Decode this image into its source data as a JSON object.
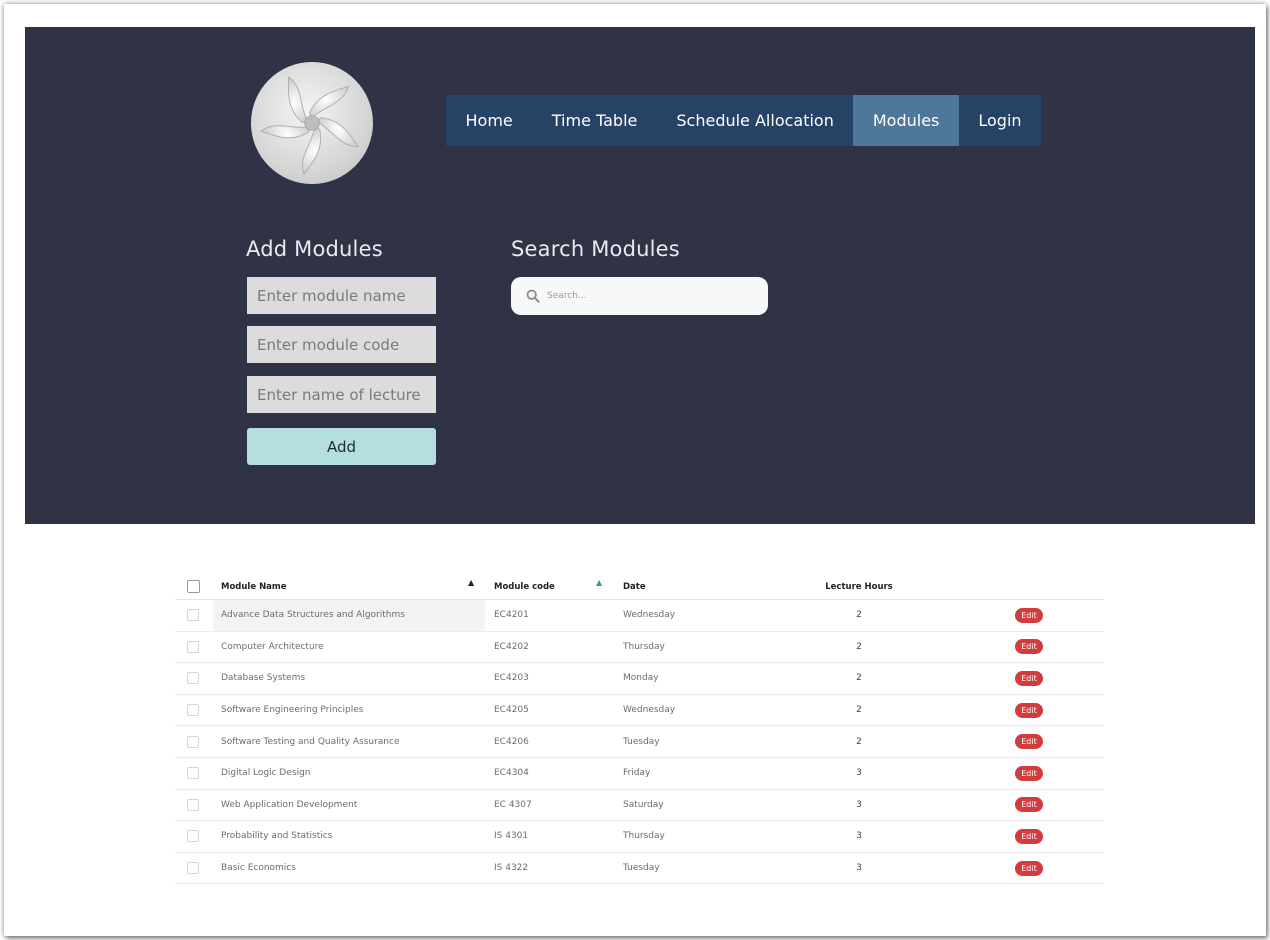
{
  "nav": {
    "items": [
      {
        "label": "Home",
        "active": false
      },
      {
        "label": "Time Table",
        "active": false
      },
      {
        "label": "Schedule Allocation",
        "active": false
      },
      {
        "label": "Modules",
        "active": true
      },
      {
        "label": "Login",
        "active": false
      }
    ]
  },
  "add_modules": {
    "title": "Add Modules",
    "module_name_placeholder": "Enter module name",
    "module_code_placeholder": "Enter module code",
    "lecturer_placeholder": "Enter name of lecture",
    "add_label": "Add"
  },
  "search_modules": {
    "title": "Search Modules",
    "placeholder": "Search..."
  },
  "table": {
    "headers": {
      "name": "Module Name",
      "code": "Module code",
      "date": "Date",
      "hours": "Lecture Hours"
    },
    "edit_label": "Edit",
    "rows": [
      {
        "name": "Advance Data Structures and Algorithms",
        "code": "EC4201",
        "date": "Wednesday",
        "hours": "2"
      },
      {
        "name": "Computer Architecture",
        "code": "EC4202",
        "date": "Thursday",
        "hours": "2"
      },
      {
        "name": "Database Systems",
        "code": "EC4203",
        "date": "Monday",
        "hours": "2"
      },
      {
        "name": "Software Engineering Principles",
        "code": "EC4205",
        "date": "Wednesday",
        "hours": "2"
      },
      {
        "name": "Software Testing and Quality Assurance",
        "code": "EC4206",
        "date": "Tuesday",
        "hours": "2"
      },
      {
        "name": "Digital Logic Design",
        "code": "EC4304",
        "date": "Friday",
        "hours": "3"
      },
      {
        "name": "Web Application Development",
        "code": "EC 4307",
        "date": "Saturday",
        "hours": "3"
      },
      {
        "name": "Probability and Statistics",
        "code": "IS 4301",
        "date": "Thursday",
        "hours": "3"
      },
      {
        "name": "Basic Economics",
        "code": "IS 4322",
        "date": "Tuesday",
        "hours": "3"
      }
    ]
  },
  "colors": {
    "hero_bg": "#2f3345",
    "nav_bg": "#264264",
    "nav_active": "#4e7799",
    "add_button": "#b3dfdf",
    "edit_button": "#d23c3f"
  }
}
